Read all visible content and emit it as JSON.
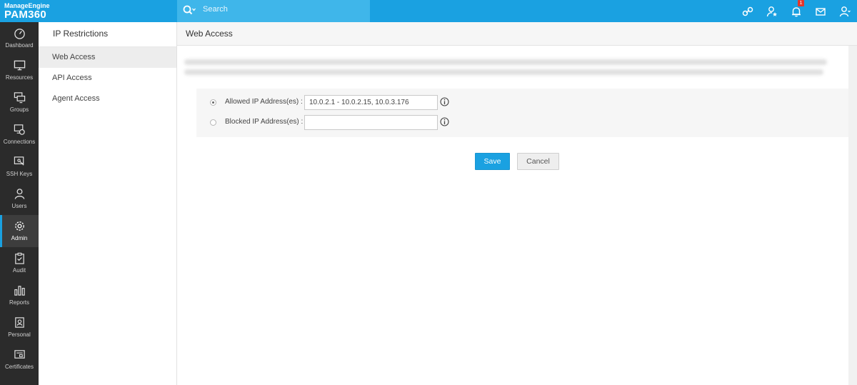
{
  "app": {
    "brand": "ManageEngine",
    "product": "PAM360"
  },
  "search": {
    "placeholder": "Search"
  },
  "top_icons": [
    {
      "name": "link-icon"
    },
    {
      "name": "user-star-icon"
    },
    {
      "name": "bell-icon",
      "badge": "1"
    },
    {
      "name": "mail-icon"
    },
    {
      "name": "user-account-icon"
    }
  ],
  "leftnav": {
    "items": [
      {
        "label": "Dashboard",
        "icon": "dashboard-icon"
      },
      {
        "label": "Resources",
        "icon": "monitor-icon"
      },
      {
        "label": "Groups",
        "icon": "groups-icon"
      },
      {
        "label": "Connections",
        "icon": "connections-icon"
      },
      {
        "label": "SSH Keys",
        "icon": "ssh-keys-icon"
      },
      {
        "label": "Users",
        "icon": "user-icon"
      },
      {
        "label": "Admin",
        "icon": "gear-icon",
        "active": true
      },
      {
        "label": "Audit",
        "icon": "clipboard-icon"
      },
      {
        "label": "Reports",
        "icon": "bar-chart-icon"
      },
      {
        "label": "Personal",
        "icon": "personal-icon"
      },
      {
        "label": "Certificates",
        "icon": "certificate-icon"
      }
    ]
  },
  "submenu": {
    "title": "IP Restrictions",
    "items": [
      {
        "label": "Web Access",
        "active": true
      },
      {
        "label": "API Access"
      },
      {
        "label": "Agent Access"
      }
    ]
  },
  "main": {
    "title": "Web Access",
    "allowed": {
      "label": "Allowed IP Address(es) :",
      "value": "10.0.2.1 - 10.0.2.15, 10.0.3.176",
      "selected": true
    },
    "blocked": {
      "label": "Blocked IP Address(es) :",
      "value": "",
      "selected": false
    },
    "save_label": "Save",
    "cancel_label": "Cancel"
  },
  "colors": {
    "accent": "#1aa1e1",
    "nav_bg": "#2b2b2b",
    "badge": "#e3372c"
  }
}
